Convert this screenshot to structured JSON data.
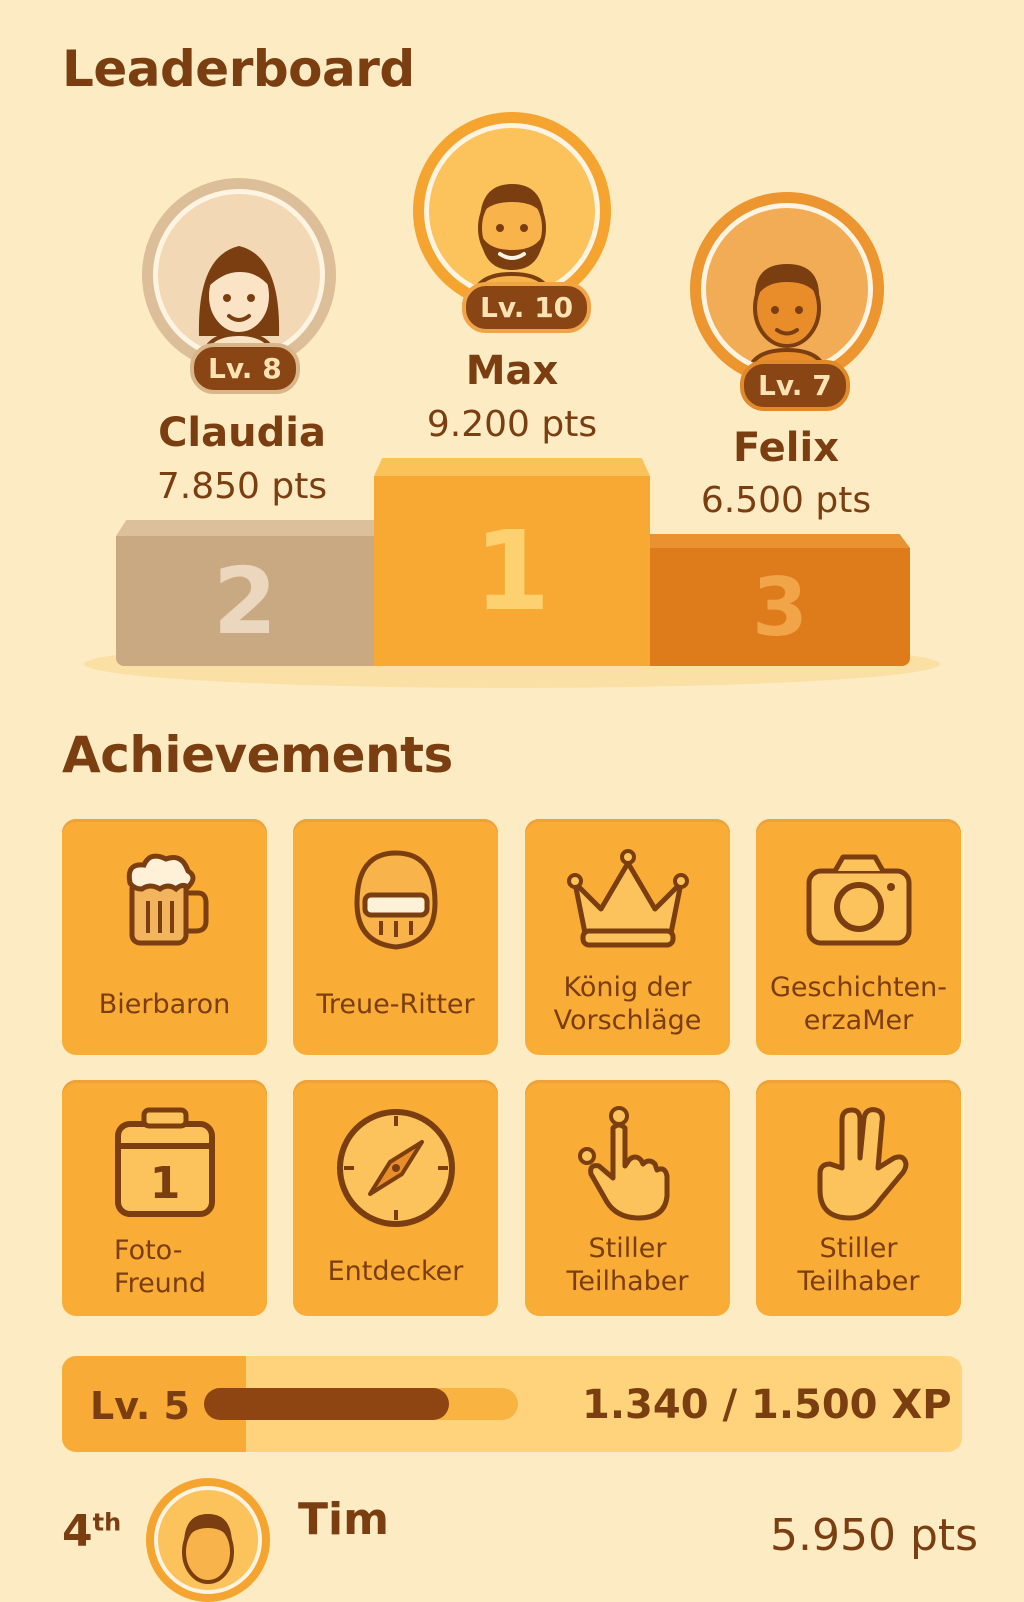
{
  "leaderboard": {
    "title": "Leaderboard",
    "podium": [
      {
        "rank": "2",
        "name": "Claudia",
        "level": "Lv. 8",
        "points": "7.850 pts"
      },
      {
        "rank": "1",
        "name": "Max",
        "level": "Lv. 10",
        "points": "9.200 pts"
      },
      {
        "rank": "3",
        "name": "Felix",
        "level": "Lv. 7",
        "points": "6.500 pts"
      }
    ]
  },
  "achievements": {
    "title": "Achievements",
    "items": [
      {
        "label": "Bierbaron",
        "icon": "beer-mug-icon"
      },
      {
        "label": "Treue-Ritter",
        "icon": "knight-helmet-icon"
      },
      {
        "label": "König der Vorschläge",
        "icon": "crown-icon"
      },
      {
        "label": "Geschichten-erzaMer",
        "icon": "camera-icon"
      },
      {
        "label": "Foto-Freund",
        "icon": "calendar-icon"
      },
      {
        "label": "Entdecker",
        "icon": "compass-icon"
      },
      {
        "label": "Stiller Teilhaber",
        "icon": "pointing-hand-icon"
      },
      {
        "label": "Stiller Teilhaber",
        "icon": "peace-hand-icon"
      }
    ]
  },
  "xp": {
    "level": "Lv. 5",
    "progress_text": "1.340 / 1.500 XP",
    "progress_fraction": 0.78
  },
  "rank4": {
    "place": "4",
    "place_suffix": "th",
    "name": "Tim",
    "points": "5.950 pts"
  },
  "colors": {
    "background": "#fdebc4",
    "primary": "#f9ac36",
    "text": "#7a3e10",
    "silver": "#c9a981",
    "bronze": "#de7c1c"
  }
}
